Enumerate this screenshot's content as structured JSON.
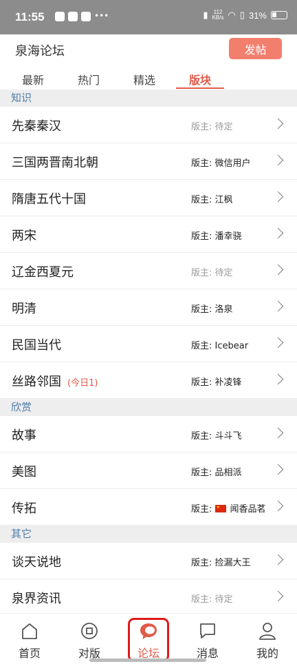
{
  "status_bar": {
    "time": "11:55",
    "net_speed_top": "112",
    "net_speed_unit": "KB/s",
    "battery": "31%"
  },
  "header": {
    "title": "泉海论坛",
    "post_button": "发帖"
  },
  "tabs": [
    {
      "label": "最新"
    },
    {
      "label": "热门"
    },
    {
      "label": "精选"
    },
    {
      "label": "版块",
      "active": true
    }
  ],
  "sections": [
    {
      "title": "知识",
      "boards": [
        {
          "name": "先秦秦汉",
          "moderator": "版主: 待定",
          "pending": true
        },
        {
          "name": "三国两晋南北朝",
          "moderator": "版主: 微信用户"
        },
        {
          "name": "隋唐五代十国",
          "moderator": "版主: 江枫"
        },
        {
          "name": "两宋",
          "moderator": "版主: 潘幸骁"
        },
        {
          "name": "辽金西夏元",
          "moderator": "版主: 待定",
          "pending": true
        },
        {
          "name": "明清",
          "moderator": "版主: 洛泉"
        },
        {
          "name": "民国当代",
          "moderator": "版主: Icebear"
        },
        {
          "name": "丝路邻国",
          "today": "(今日1)",
          "moderator": "版主: 补凌锋"
        }
      ]
    },
    {
      "title": "欣赏",
      "boards": [
        {
          "name": "故事",
          "moderator": "版主: 斗斗飞"
        },
        {
          "name": "美图",
          "moderator": "版主: 品相派"
        },
        {
          "name": "传拓",
          "moderator_prefix": "版主: ",
          "moderator_name": "闻香品茗",
          "flag": "china-flag-icon"
        }
      ]
    },
    {
      "title": "其它",
      "boards": [
        {
          "name": "谈天说地",
          "moderator": "版主: 捡漏大王"
        },
        {
          "name": "泉界资讯",
          "moderator": "版主: 待定",
          "pending": true
        }
      ]
    }
  ],
  "bottom_nav": [
    {
      "label": "首页",
      "icon": "home-icon"
    },
    {
      "label": "对版",
      "icon": "compare-icon"
    },
    {
      "label": "论坛",
      "icon": "forum-icon",
      "active": true
    },
    {
      "label": "消息",
      "icon": "message-icon"
    },
    {
      "label": "我的",
      "icon": "profile-icon"
    }
  ],
  "colors": {
    "accent": "#e05a4a",
    "post_button": "#f27f6e",
    "section_text": "#4d7aa8",
    "highlight_box": "#e01818"
  }
}
